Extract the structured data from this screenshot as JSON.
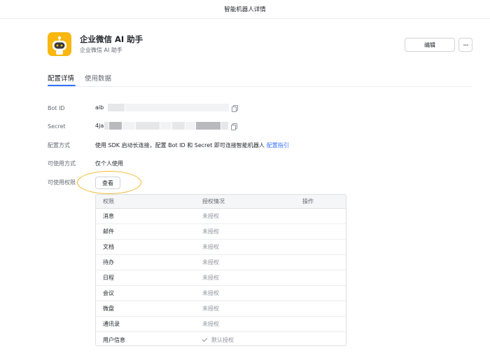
{
  "header": {
    "title": "智能机器人详情"
  },
  "bot": {
    "name": "企业微信 AI 助手",
    "subtitle": "企业微信 AI 助手",
    "logo_color": "#f9b70f"
  },
  "actions": {
    "edit_label": "编辑",
    "more_label": "···"
  },
  "tabs": [
    {
      "label": "配置详情",
      "active": true
    },
    {
      "label": "使用数据",
      "active": false
    }
  ],
  "fields": {
    "bot_id": {
      "label": "Bot ID",
      "value": "aib"
    },
    "secret": {
      "label": "Secret",
      "value": "4ja"
    },
    "config_method": {
      "label": "配置方式",
      "value": "使用 SDK 启动长连接，配置 Bot ID 和 Secret 即可连接智能机器人",
      "link": "配置指引"
    },
    "usage_method": {
      "label": "可使用方式",
      "value": "仅个人使用"
    },
    "permissions": {
      "label": "可使用权限",
      "button_label": "查看"
    }
  },
  "permissions_table": {
    "columns": [
      "权限",
      "授权情况",
      "操作"
    ],
    "rows": [
      {
        "name": "消息",
        "status": "未授权"
      },
      {
        "name": "邮件",
        "status": "未授权"
      },
      {
        "name": "文档",
        "status": "未授权"
      },
      {
        "name": "待办",
        "status": "未授权"
      },
      {
        "name": "日程",
        "status": "未授权"
      },
      {
        "name": "会议",
        "status": "未授权"
      },
      {
        "name": "微盘",
        "status": "未授权"
      },
      {
        "name": "通讯录",
        "status": "未授权"
      },
      {
        "name": "用户信息",
        "status": "默认授权"
      }
    ]
  },
  "colors": {
    "accent": "#3370ff",
    "highlight": "#f3b72b"
  }
}
